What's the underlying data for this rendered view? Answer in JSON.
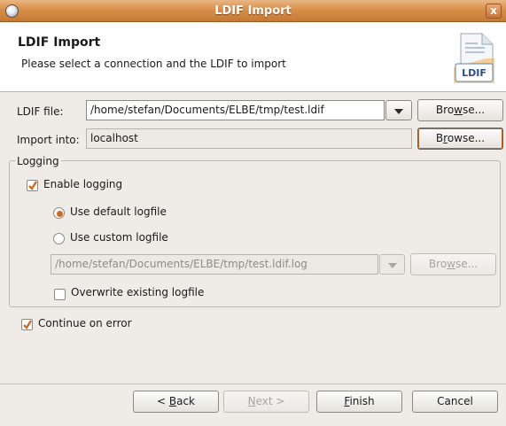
{
  "window": {
    "title": "LDIF Import",
    "close_glyph": "x"
  },
  "header": {
    "title": "LDIF Import",
    "description": "Please select a connection and the LDIF to import",
    "icon_label": "LDIF"
  },
  "ldif_file": {
    "label": "LDIF file:",
    "value": "/home/stefan/Documents/ELBE/tmp/test.ldif",
    "browse_pre": "Bro",
    "browse_mn": "w",
    "browse_post": "se..."
  },
  "import_into": {
    "label": "Import into:",
    "value": "localhost",
    "browse_pre": "B",
    "browse_mn": "r",
    "browse_post": "owse..."
  },
  "logging": {
    "group_label": "Logging",
    "enable_label": "Enable logging",
    "enable_checked": true,
    "default_label": "Use default logfile",
    "custom_label": "Use custom logfile",
    "selected": "default",
    "logfile_value": "/home/stefan/Documents/ELBE/tmp/test.ldif.log",
    "browse_pre": "Bro",
    "browse_mn": "w",
    "browse_post": "se...",
    "overwrite_label": "Overwrite existing logfile",
    "overwrite_checked": false
  },
  "continue_on_error": {
    "label": "Continue on error",
    "checked": true
  },
  "buttons": {
    "back_pre": "< ",
    "back_mn": "B",
    "back_post": "ack",
    "next_pre": "",
    "next_mn": "N",
    "next_post": "ext >",
    "finish_pre": "",
    "finish_mn": "F",
    "finish_post": "inish",
    "cancel": "Cancel"
  },
  "colors": {
    "title_bar": "#d88f4a",
    "accent": "#d06a1e",
    "dialog_bg": "#efebe7"
  }
}
